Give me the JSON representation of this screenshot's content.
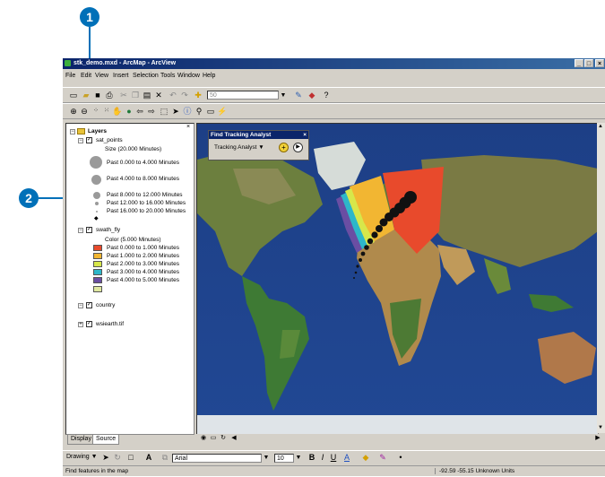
{
  "callouts": {
    "one": "1",
    "two": "2"
  },
  "window": {
    "title": "stk_demo.mxd - ArcMap - ArcView",
    "minimize": "_",
    "maximize": "□",
    "close": "×"
  },
  "menu": [
    "File",
    "Edit",
    "View",
    "Insert",
    "Selection",
    "Tools",
    "Window",
    "Help"
  ],
  "standard_toolbar": {
    "scale_value": "50"
  },
  "toc": {
    "root": "Layers",
    "layers": [
      {
        "name": "sat_points",
        "legend_title": "Size (20.000 Minutes)",
        "items": [
          "Past 0.000 to 4.000 Minutes",
          "Past 4.000 to 8.000 Minutes",
          "Past 8.000 to 12.000 Minutes",
          "Past 12.000 to 16.000 Minutes",
          "Past 16.000 to 20.000 Minutes"
        ]
      },
      {
        "name": "swath_fly",
        "legend_title": "Color (5.000 Minutes)",
        "items": [
          {
            "label": "Past 0.000 to 1.000 Minutes",
            "color": "#e84a2c"
          },
          {
            "label": "Past 1.000 to 2.000 Minutes",
            "color": "#f2b632"
          },
          {
            "label": "Past 2.000 to 3.000 Minutes",
            "color": "#d7e74a"
          },
          {
            "label": "Past 3.000 to 4.000 Minutes",
            "color": "#2db7c9"
          },
          {
            "label": "Past 4.000 to 5.000 Minutes",
            "color": "#6a4ea3"
          }
        ],
        "extra_swatch": "#e0e8a0"
      },
      {
        "name": "country"
      },
      {
        "name": "wsiearth.tif"
      }
    ],
    "tabs": [
      "Display",
      "Source"
    ]
  },
  "tracking_analyst": {
    "title": "Find Tracking Analyst",
    "dropdown": "Tracking Analyst ▼"
  },
  "drawing_toolbar": {
    "drawing": "Drawing ▼",
    "font": "Arial",
    "size": "10"
  },
  "status": {
    "message": "Find features in the map",
    "coords": "-92.59  -55.15 Unknown Units"
  }
}
